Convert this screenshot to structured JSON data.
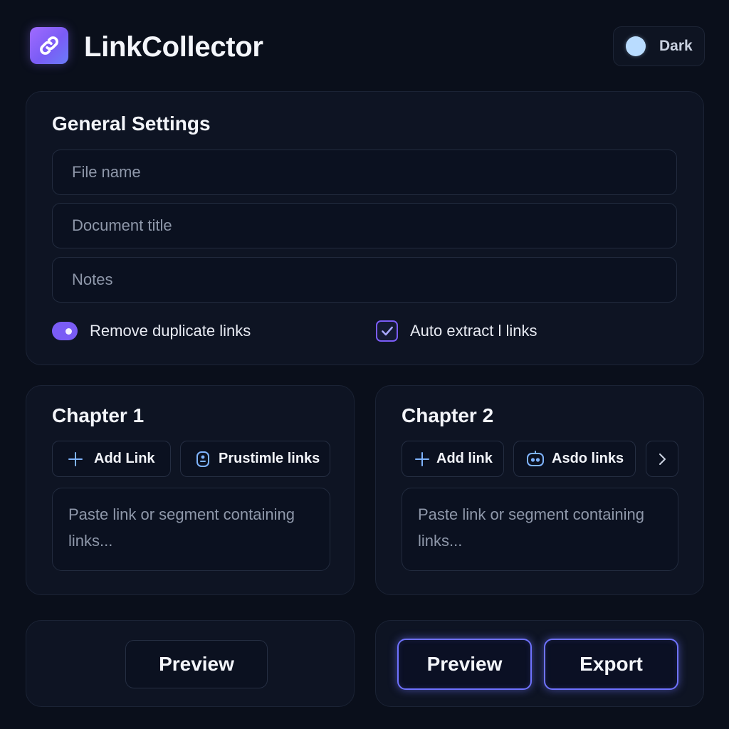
{
  "app": {
    "title": "LinkCollector",
    "logo_icon": "link-icon",
    "accent": "#7a5cf5"
  },
  "theme": {
    "label": "Dark",
    "dot_color": "#b9dcff"
  },
  "general": {
    "title": "General Settings",
    "fields": {
      "file_name_placeholder": "File name",
      "document_title_placeholder": "Document title",
      "notes_placeholder": "Notes"
    },
    "remove_duplicates": {
      "label": "Remove duplicate links",
      "on": true
    },
    "auto_extract": {
      "label": "Auto extract l links",
      "checked": true
    }
  },
  "chapters": [
    {
      "title": "Chapter 1",
      "add_label": "Add Link",
      "secondary_label": "Prustimle links",
      "secondary_icon": "badge-icon",
      "placeholder": "Paste link or segment containing links..."
    },
    {
      "title": "Chapter 2",
      "add_label": "Add link",
      "secondary_label": "Asdo links",
      "secondary_icon": "bot-icon",
      "more_icon": "chevron-right-icon",
      "placeholder": "Paste link or segment containing links..."
    }
  ],
  "footer": {
    "left": {
      "preview_label": "Preview"
    },
    "right": {
      "preview_label": "Preview",
      "export_label": "Export",
      "glow_color": "#6f72ff"
    }
  }
}
